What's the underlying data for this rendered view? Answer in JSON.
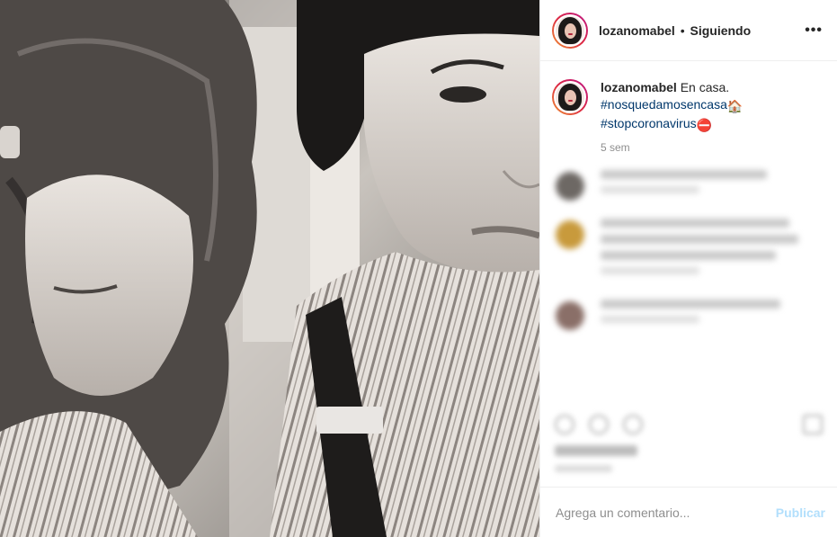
{
  "post": {
    "username": "lozanomabel",
    "separator": "•",
    "follow_status": "Siguiendo",
    "more_icon": "ellipsis-icon",
    "photo": {
      "description_icon": "photo-image",
      "tone": "black-and-white"
    }
  },
  "caption": {
    "username": "lozanomabel",
    "text": "En casa.",
    "hashtag_1": "#nosquedamosencasa",
    "emoji_1": "🏠",
    "hashtag_2": "#stopcoronavirus",
    "emoji_2": "⛔",
    "time": "5 sem"
  },
  "comment_box": {
    "placeholder": "Agrega un comentario...",
    "publish_label": "Publicar"
  },
  "colors": {
    "hashtag": "#00376b",
    "publish_disabled": "#b2dffc",
    "muted": "#8e8e8e",
    "border": "#efefef"
  }
}
